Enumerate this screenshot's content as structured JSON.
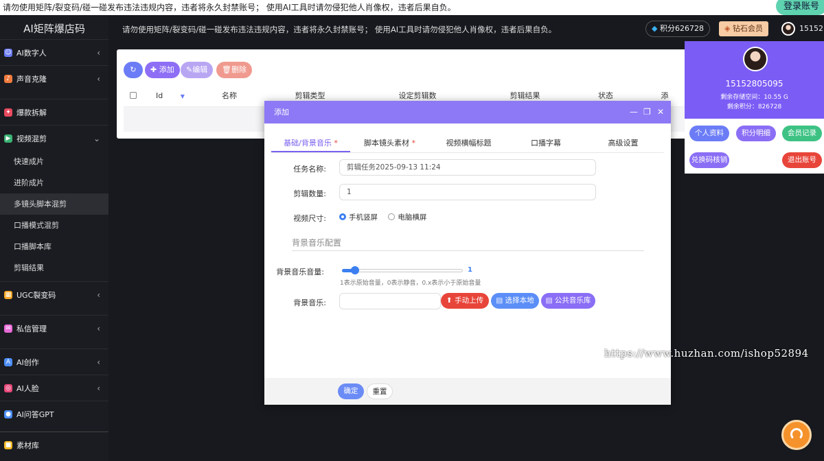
{
  "notice_top": "请勿使用矩阵/裂变码/碰一碰发布违法违规内容，违者将永久封禁账号；  使用AI工具时请勿侵犯他人肖像权，违者后果自负。",
  "login_button": "登录账号",
  "app_title": "AI矩阵爆店码",
  "header": {
    "notice": "请勿使用矩阵/裂变码/碰一碰发布违法违规内容，违者将永久封禁账号；  使用AI工具时请勿侵犯他人肖像权，违者后果自负。",
    "points": "积分626728",
    "vip": "钻石会员",
    "user": "15152"
  },
  "sidebar": {
    "items": [
      {
        "label": "AI数字人",
        "icon": "users-icon",
        "color": "#6b7cf6"
      },
      {
        "label": "声音克隆",
        "icon": "audio-icon",
        "color": "#f07c3e"
      },
      {
        "label": "爆款拆解",
        "icon": "fire-icon",
        "color": "#e84a5f"
      },
      {
        "label": "视频混剪",
        "icon": "video-icon",
        "color": "#3bb273"
      },
      {
        "label": "UGC裂变码",
        "icon": "grid-icon",
        "color": "#f5a623"
      },
      {
        "label": "私信管理",
        "icon": "message-icon",
        "color": "#e86ad8"
      },
      {
        "label": "AI创作",
        "icon": "ai-icon",
        "color": "#4d8ef7"
      },
      {
        "label": "AI人脸",
        "icon": "face-icon",
        "color": "#e8487a"
      },
      {
        "label": "AI问答GPT",
        "icon": "chat-icon",
        "color": "#4d8ef7"
      },
      {
        "label": "素材库",
        "icon": "folder-icon",
        "color": "#f5b923"
      }
    ],
    "subitems": [
      "快速成片",
      "进阶成片",
      "多镜头脚本混剪",
      "口播模式混剪",
      "口播脚本库",
      "剪辑结果"
    ]
  },
  "toolbar": {
    "refresh": "",
    "add": "添加",
    "edit": "编辑",
    "delete": "删除"
  },
  "table": {
    "columns": [
      "Id",
      "名称",
      "剪辑类型",
      "设定剪辑数",
      "剪辑结果",
      "状态",
      "添"
    ]
  },
  "modal": {
    "title": "添加",
    "tabs": [
      "基础/背景音乐",
      "脚本镜头素材",
      "视频横幅标题",
      "口播字幕",
      "高级设置"
    ],
    "task_name_label": "任务名称:",
    "task_name_value": "剪辑任务2025-09-13 11:24",
    "count_label": "剪辑数量:",
    "count_value": "1",
    "size_label": "视频尺寸:",
    "size_options": [
      "手机竖屏",
      "电脑横屏"
    ],
    "section_title": "背景音乐配置",
    "volume_label": "背景音乐音量:",
    "volume_value": "1",
    "volume_hint": "1表示原始音量，0表示静音，0.x表示小于原始音量",
    "music_label": "背景音乐:",
    "upload": "手动上传",
    "choose_local": "选择本地",
    "public_library": "公共音乐库",
    "confirm": "确定",
    "reset": "重置"
  },
  "user_panel": {
    "phone": "15152805095",
    "storage": "剩余存储空间：10.55 G",
    "points": "剩余积分：826728",
    "profile": "个人资料",
    "points_detail": "积分明细",
    "member_record": "会员记录",
    "redeem": "兑换码核销",
    "logout": "退出账号"
  },
  "watermark": "https://www.huzhan.com/ishop52894"
}
